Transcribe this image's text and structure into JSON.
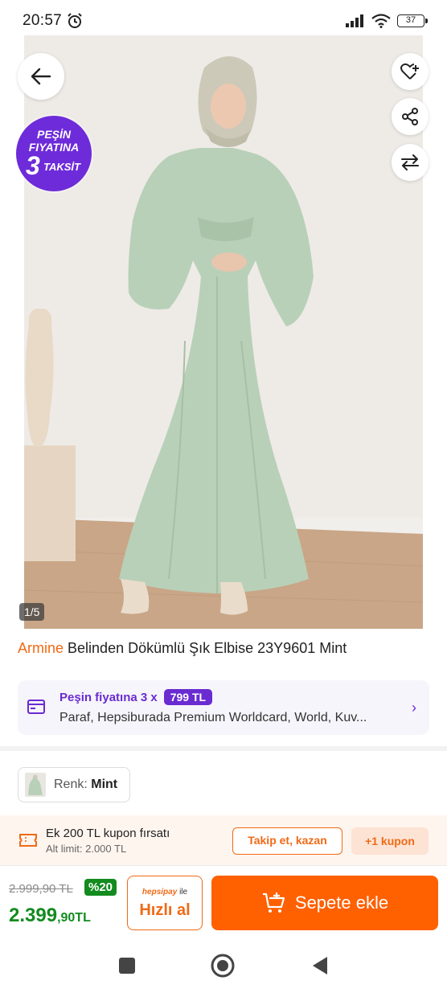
{
  "status_bar": {
    "time": "20:57",
    "battery": "37",
    "icons": [
      "alarm-icon",
      "signal-icon",
      "wifi-icon",
      "battery-icon"
    ]
  },
  "gallery": {
    "badge": {
      "line1": "PEŞİN",
      "line2": "FIYATINA",
      "line3": "3",
      "line4": "TAKSİT"
    },
    "counter": "1/5",
    "icons": [
      "back-arrow-icon",
      "heart-add-icon",
      "share-icon",
      "compare-icon"
    ]
  },
  "product": {
    "brand": "Armine",
    "name": "Belinden Dökümlü Şık Elbise 23Y9601 Mint"
  },
  "installment": {
    "label": "Peşin fiyatına 3 x",
    "price": "799 TL",
    "cards": "Paraf, Hepsiburada Premium Worldcard, World, Kuv..."
  },
  "color": {
    "label": "Renk:",
    "value": "Mint"
  },
  "coupon": {
    "title": "Ek 200 TL kupon fırsatı",
    "subtitle": "Alt limit: 2.000 TL",
    "follow_label": "Takip et, kazan",
    "coupon_label": "+1 kupon"
  },
  "purchase": {
    "old_price": "2.999,90 TL",
    "discount": "%20",
    "price_main": "2.399",
    "price_decimal": ",90TL",
    "hepsipay": "hepsipay",
    "ile": "ile",
    "hizli_label": "Hızlı al",
    "cart_label": "Sepete ekle"
  },
  "colors": {
    "brand_orange": "#ff6000",
    "purple": "#6a2bd1",
    "green": "#138b1f",
    "dress_mint": "#b9d0b8"
  }
}
